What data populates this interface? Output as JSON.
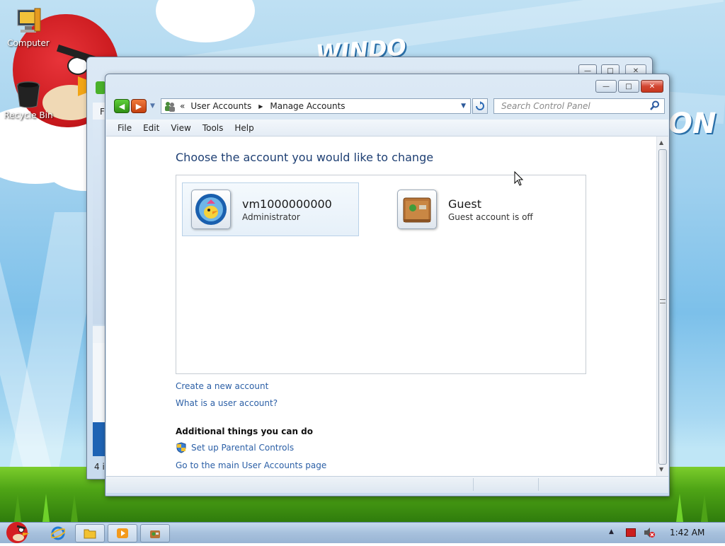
{
  "desktop": {
    "icons": [
      {
        "label": "Computer"
      },
      {
        "label": "Recycle Bin"
      }
    ]
  },
  "back_window": {
    "menu_fragment": "F",
    "status_fragment": "4 i"
  },
  "window": {
    "breadcrumb_chevrons": "«",
    "breadcrumb": [
      "User Accounts",
      "Manage Accounts"
    ],
    "search_placeholder": "Search Control Panel",
    "menu": [
      "File",
      "Edit",
      "View",
      "Tools",
      "Help"
    ],
    "heading": "Choose the account you would like to change",
    "accounts": [
      {
        "name": "vm1000000000",
        "role": "Administrator",
        "selected": true
      },
      {
        "name": "Guest",
        "role": "Guest account is off",
        "selected": false
      }
    ],
    "links": {
      "create": "Create a new account",
      "what_is": "What is a user account?"
    },
    "additional": {
      "heading": "Additional things you can do",
      "parental": "Set up Parental Controls",
      "main_page": "Go to the main User Accounts page"
    }
  },
  "taskbar": {
    "clock": "1:42 AM"
  },
  "colors": {
    "link": "#2b5fa6",
    "heading": "#1e3f73",
    "selection": "#eef5fb"
  }
}
